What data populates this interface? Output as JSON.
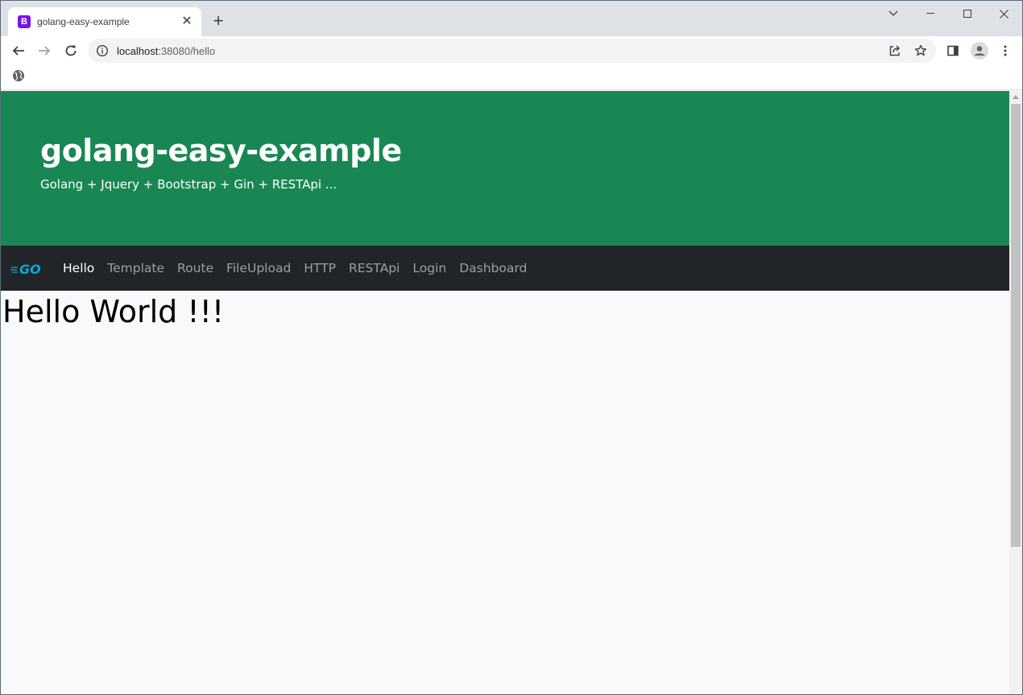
{
  "browser": {
    "tab": {
      "favicon_letter": "B",
      "title": "golang-easy-example",
      "close": "✕"
    },
    "newtab": "+",
    "address": {
      "host": "localhost",
      "path": ":38080/hello"
    }
  },
  "page": {
    "hero": {
      "title": "golang-easy-example",
      "subtitle": "Golang + Jquery + Bootstrap + Gin + RESTApi ..."
    },
    "navbar": {
      "logo_text": "GO",
      "links": [
        "Hello",
        "Template",
        "Route",
        "FileUpload",
        "HTTP",
        "RESTApi",
        "Login",
        "Dashboard"
      ]
    },
    "heading": "Hello World !!!"
  },
  "colors": {
    "hero_bg": "#198754",
    "navbar_bg": "#212529",
    "go_logo": "#00add8",
    "favicon": "#7a14e8"
  }
}
